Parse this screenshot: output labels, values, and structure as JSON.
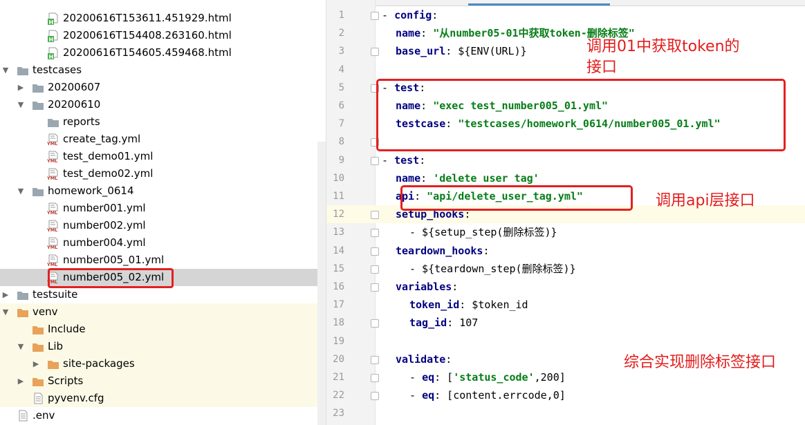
{
  "tree": {
    "rows": [
      {
        "label": "20200616T153611.451929.html",
        "kind": "html",
        "indent": 2
      },
      {
        "label": "20200616T154408.263160.html",
        "kind": "html",
        "indent": 2
      },
      {
        "label": "20200616T154605.459468.html",
        "kind": "html",
        "indent": 2
      },
      {
        "label": "testcases",
        "kind": "folder",
        "indent": 0,
        "arrow": "down"
      },
      {
        "label": "20200607",
        "kind": "folder",
        "indent": 1,
        "arrow": "right"
      },
      {
        "label": "20200610",
        "kind": "folder",
        "indent": 1,
        "arrow": "down"
      },
      {
        "label": "reports",
        "kind": "folder",
        "indent": 2
      },
      {
        "label": "create_tag.yml",
        "kind": "yml",
        "indent": 2
      },
      {
        "label": "test_demo01.yml",
        "kind": "yml",
        "indent": 2
      },
      {
        "label": "test_demo02.yml",
        "kind": "yml",
        "indent": 2
      },
      {
        "label": "homework_0614",
        "kind": "folder",
        "indent": 1,
        "arrow": "down"
      },
      {
        "label": "number001.yml",
        "kind": "yml",
        "indent": 2
      },
      {
        "label": "number002.yml",
        "kind": "yml",
        "indent": 2
      },
      {
        "label": "number004.yml",
        "kind": "yml",
        "indent": 2
      },
      {
        "label": "number005_01.yml",
        "kind": "yml",
        "indent": 2
      },
      {
        "label": "number005_02.yml",
        "kind": "yml",
        "indent": 2,
        "selected": true
      },
      {
        "label": "testsuite",
        "kind": "folder",
        "indent": 0,
        "arrow": "right"
      },
      {
        "label": "venv",
        "kind": "folder-orange",
        "indent": 0,
        "arrow": "down",
        "venv": true
      },
      {
        "label": "Include",
        "kind": "folder-orange",
        "indent": 1,
        "venv": true
      },
      {
        "label": "Lib",
        "kind": "folder-orange",
        "indent": 1,
        "arrow": "down",
        "venv": true
      },
      {
        "label": "site-packages",
        "kind": "folder-orange",
        "indent": 2,
        "arrow": "right",
        "venv": true
      },
      {
        "label": "Scripts",
        "kind": "folder-orange",
        "indent": 1,
        "arrow": "right",
        "venv": true
      },
      {
        "label": "pyvenv.cfg",
        "kind": "file",
        "indent": 1,
        "venv": true
      },
      {
        "label": ".env",
        "kind": "file",
        "indent": 0
      }
    ]
  },
  "editor": {
    "lines": [
      {
        "n": "1",
        "indent": 0,
        "parts": [
          [
            "p",
            "- "
          ],
          [
            "k",
            "config"
          ],
          [
            "p",
            ":"
          ]
        ]
      },
      {
        "n": "2",
        "indent": 2,
        "parts": [
          [
            "k",
            "name"
          ],
          [
            "p",
            ": "
          ],
          [
            "s",
            "\"从number05-01中获取token-删除标签\""
          ]
        ]
      },
      {
        "n": "3",
        "indent": 2,
        "parts": [
          [
            "k",
            "base_url"
          ],
          [
            "p",
            ": ${ENV(URL)}"
          ]
        ]
      },
      {
        "n": "4",
        "indent": 0,
        "parts": []
      },
      {
        "n": "5",
        "indent": 0,
        "parts": [
          [
            "p",
            "- "
          ],
          [
            "k",
            "test"
          ],
          [
            "p",
            ":"
          ]
        ]
      },
      {
        "n": "6",
        "indent": 2,
        "parts": [
          [
            "k",
            "name"
          ],
          [
            "p",
            ": "
          ],
          [
            "s",
            "\"exec test_number005_01.yml\""
          ]
        ]
      },
      {
        "n": "7",
        "indent": 2,
        "parts": [
          [
            "k",
            "testcase"
          ],
          [
            "p",
            ": "
          ],
          [
            "s",
            "\"testcases/homework_0614/number005_01.yml\""
          ]
        ]
      },
      {
        "n": "8",
        "indent": 0,
        "parts": []
      },
      {
        "n": "9",
        "indent": 0,
        "parts": [
          [
            "p",
            "- "
          ],
          [
            "k",
            "test"
          ],
          [
            "p",
            ":"
          ]
        ]
      },
      {
        "n": "10",
        "indent": 2,
        "parts": [
          [
            "k",
            "name"
          ],
          [
            "p",
            ": "
          ],
          [
            "s",
            "'delete user tag'"
          ]
        ]
      },
      {
        "n": "11",
        "indent": 2,
        "parts": [
          [
            "k",
            "api"
          ],
          [
            "p",
            ": "
          ],
          [
            "s",
            "\"api/delete_user_tag.yml\""
          ]
        ]
      },
      {
        "n": "12",
        "indent": 2,
        "parts": [
          [
            "k",
            "setup_hooks"
          ],
          [
            "p",
            ":"
          ]
        ],
        "highlight": true
      },
      {
        "n": "13",
        "indent": 4,
        "parts": [
          [
            "p",
            "- ${setup_step(删除标签)}"
          ]
        ]
      },
      {
        "n": "14",
        "indent": 2,
        "parts": [
          [
            "k",
            "teardown_hooks"
          ],
          [
            "p",
            ":"
          ]
        ]
      },
      {
        "n": "15",
        "indent": 4,
        "parts": [
          [
            "p",
            "- ${teardown_step(删除标签)}"
          ]
        ]
      },
      {
        "n": "16",
        "indent": 2,
        "parts": [
          [
            "k",
            "variables"
          ],
          [
            "p",
            ":"
          ]
        ]
      },
      {
        "n": "17",
        "indent": 4,
        "parts": [
          [
            "k",
            "token_id"
          ],
          [
            "p",
            ": $token_id"
          ]
        ]
      },
      {
        "n": "18",
        "indent": 4,
        "parts": [
          [
            "k",
            "tag_id"
          ],
          [
            "p",
            ": 107"
          ]
        ]
      },
      {
        "n": "19",
        "indent": 0,
        "parts": []
      },
      {
        "n": "20",
        "indent": 2,
        "parts": [
          [
            "k",
            "validate"
          ],
          [
            "p",
            ":"
          ]
        ]
      },
      {
        "n": "21",
        "indent": 4,
        "parts": [
          [
            "p",
            "- "
          ],
          [
            "k",
            "eq"
          ],
          [
            "p",
            ": ["
          ],
          [
            "s",
            "'status_code'"
          ],
          [
            "p",
            ",200]"
          ]
        ]
      },
      {
        "n": "22",
        "indent": 4,
        "parts": [
          [
            "p",
            "- "
          ],
          [
            "k",
            "eq"
          ],
          [
            "p",
            ": [content.errcode,0]"
          ]
        ]
      },
      {
        "n": "23",
        "indent": 0,
        "parts": []
      }
    ],
    "fold_lines": [
      "1",
      "3",
      "5",
      "8",
      "9",
      "12",
      "13",
      "14",
      "15",
      "16",
      "18",
      "20",
      "21",
      "22"
    ]
  },
  "annotations": {
    "note_token_line1": "调用01中获取token的",
    "note_token_line2": "接口",
    "note_api": "调用api层接口",
    "note_combined": "综合实现删除标签接口"
  },
  "colors": {
    "annotation": "#e31c1c",
    "keyword": "#000080",
    "string": "#067d17",
    "selection": "#d5d5d5",
    "venv_bg": "#fcfae6"
  }
}
